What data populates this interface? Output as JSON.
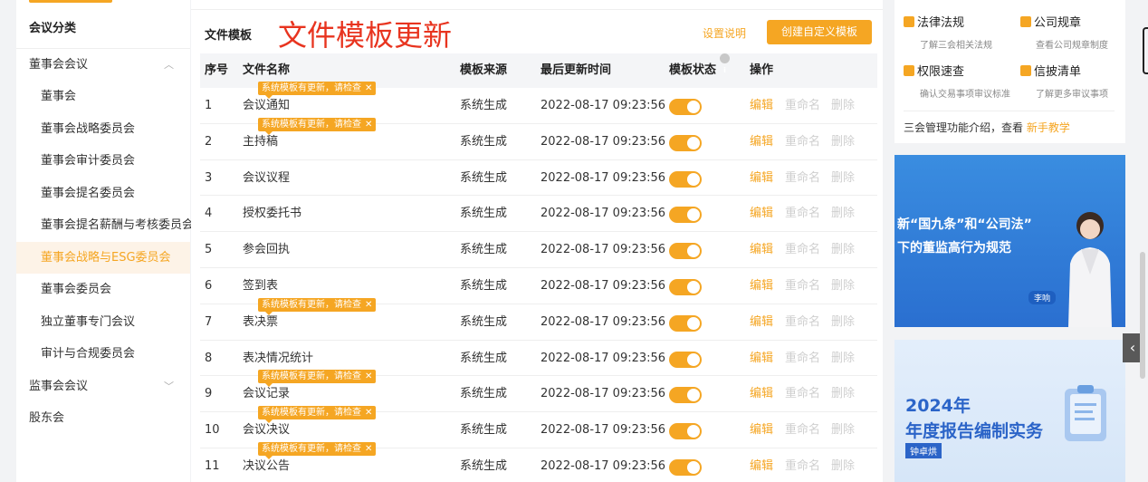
{
  "sidebar": {
    "header": "会议分类",
    "groups": [
      {
        "label": "董事会会议",
        "expanded": true
      },
      {
        "label": "监事会会议",
        "expanded": false
      },
      {
        "label": "股东会"
      }
    ],
    "board_items": [
      "董事会",
      "董事会战略委员会",
      "董事会审计委员会",
      "董事会提名委员会",
      "董事会提名薪酬与考核委员会",
      "董事会战略与ESG委员会",
      "董事会委员会",
      "独立董事专门会议",
      "审计与合规委员会"
    ],
    "active_item": "董事会战略与ESG委员会"
  },
  "main": {
    "title": "文件模板",
    "annotation": "文件模板更新",
    "help_link": "设置说明",
    "create_button": "创建自定义模板",
    "columns": {
      "idx": "序号",
      "name": "文件名称",
      "source": "模板来源",
      "updated": "最后更新时间",
      "status": "模板状态",
      "actions": "操作"
    },
    "update_tip": "系统模板有更新，请检查",
    "tip_close": "✕",
    "action_labels": {
      "edit": "编辑",
      "rename": "重命名",
      "delete": "删除"
    },
    "rows": [
      {
        "idx": "1",
        "name": "会议通知",
        "source": "系统生成",
        "updated": "2022-08-17 09:23:56",
        "enabled": true,
        "has_update": true
      },
      {
        "idx": "2",
        "name": "主持稿",
        "source": "系统生成",
        "updated": "2022-08-17 09:23:56",
        "enabled": true,
        "has_update": true
      },
      {
        "idx": "3",
        "name": "会议议程",
        "source": "系统生成",
        "updated": "2022-08-17 09:23:56",
        "enabled": true,
        "has_update": false
      },
      {
        "idx": "4",
        "name": "授权委托书",
        "source": "系统生成",
        "updated": "2022-08-17 09:23:56",
        "enabled": true,
        "has_update": false
      },
      {
        "idx": "5",
        "name": "参会回执",
        "source": "系统生成",
        "updated": "2022-08-17 09:23:56",
        "enabled": true,
        "has_update": false
      },
      {
        "idx": "6",
        "name": "签到表",
        "source": "系统生成",
        "updated": "2022-08-17 09:23:56",
        "enabled": true,
        "has_update": false
      },
      {
        "idx": "7",
        "name": "表决票",
        "source": "系统生成",
        "updated": "2022-08-17 09:23:56",
        "enabled": true,
        "has_update": true
      },
      {
        "idx": "8",
        "name": "表决情况统计",
        "source": "系统生成",
        "updated": "2022-08-17 09:23:56",
        "enabled": true,
        "has_update": false
      },
      {
        "idx": "9",
        "name": "会议记录",
        "source": "系统生成",
        "updated": "2022-08-17 09:23:56",
        "enabled": true,
        "has_update": true
      },
      {
        "idx": "10",
        "name": "会议决议",
        "source": "系统生成",
        "updated": "2022-08-17 09:23:56",
        "enabled": true,
        "has_update": true
      },
      {
        "idx": "11",
        "name": "决议公告",
        "source": "系统生成",
        "updated": "2022-08-17 09:23:56",
        "enabled": true,
        "has_update": true
      }
    ]
  },
  "right": {
    "quick_links": [
      {
        "title": "法律法规",
        "sub": "了解三会相关法规",
        "icon": "gavel-icon"
      },
      {
        "title": "公司规章",
        "sub": "查看公司规章制度",
        "icon": "rules-icon"
      },
      {
        "title": "权限速查",
        "sub": "确认交易事项审议标准",
        "icon": "shield-icon"
      },
      {
        "title": "信披清单",
        "sub": "了解更多审议事项",
        "icon": "checklist-icon"
      }
    ],
    "intro_text": "三会管理功能介绍，查看",
    "intro_link": "新手教学",
    "banner1": {
      "line1": "新“国九条”和“公司法”",
      "line2": "下的董监高行为规范",
      "presenter": "李响"
    },
    "banner2": {
      "year": "2024年",
      "title": "年度报告编制实务",
      "author": "钟卓烘"
    }
  },
  "colors": {
    "accent": "#f5a623",
    "annotation": "#e8341f",
    "banner_blue": "#2a6fd0"
  }
}
